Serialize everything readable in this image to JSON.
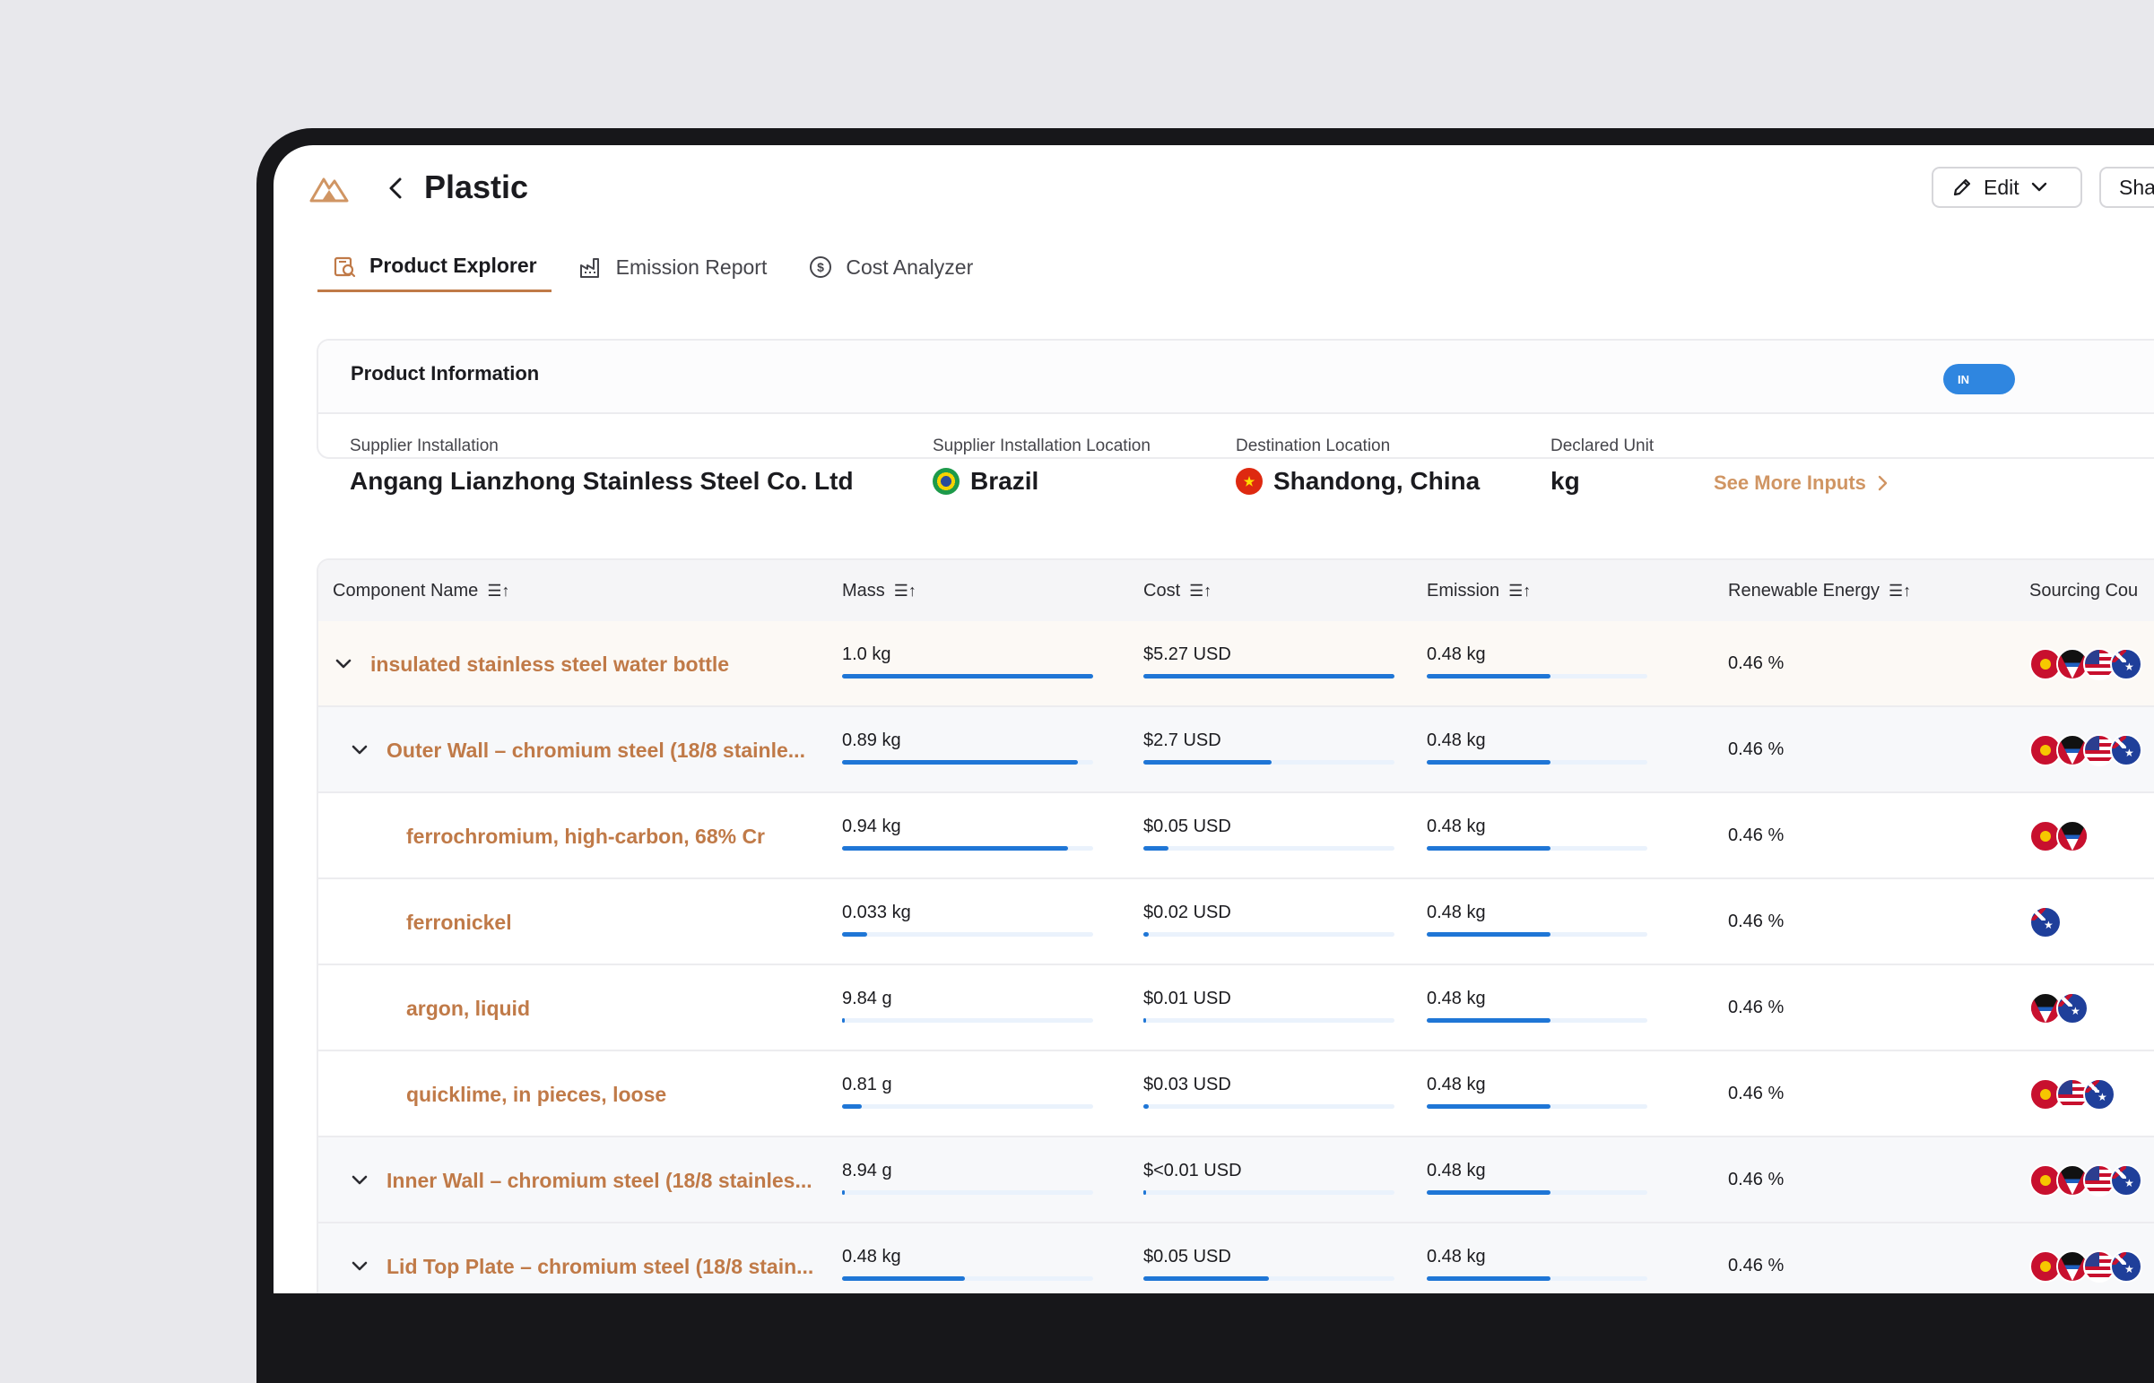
{
  "header": {
    "title": "Plastic",
    "edit_label": "Edit",
    "share_label": "Sha"
  },
  "tabs": [
    {
      "label": "Product Explorer",
      "icon": "product-search-icon",
      "active": true
    },
    {
      "label": "Emission Report",
      "icon": "factory-icon",
      "active": false
    },
    {
      "label": "Cost Analyzer",
      "icon": "dollar-circle-icon",
      "active": false
    }
  ],
  "product_info": {
    "title": "Product Information",
    "badge": "IN",
    "supplier_installation_label": "Supplier Installation",
    "supplier_installation_value": "Angang Lianzhong Stainless Steel Co. Ltd",
    "supplier_location_label": "Supplier Installation Location",
    "supplier_location_value": "Brazil",
    "destination_label": "Destination Location",
    "destination_value": "Shandong, China",
    "declared_unit_label": "Declared Unit",
    "declared_unit_value": "kg",
    "see_more": "See More Inputs"
  },
  "table": {
    "columns": [
      "Component Name",
      "Mass",
      "Cost",
      "Emission",
      "Renewable Energy",
      "Sourcing Cou"
    ],
    "rows": [
      {
        "name": "insulated stainless steel water bottle",
        "level": 0,
        "expandable": true,
        "mass": "1.0 kg",
        "mass_fill": 1.0,
        "cost": "$5.27 USD",
        "cost_fill": 1.0,
        "emission": "0.48 kg",
        "emission_fill": 0.56,
        "renewable": "0.46 %",
        "flags": [
          "kg",
          "ag",
          "us",
          "au"
        ]
      },
      {
        "name": "Outer Wall – chromium steel (18/8 stainle...",
        "level": 1,
        "expandable": true,
        "mass": "0.89 kg",
        "mass_fill": 0.94,
        "cost": "$2.7 USD",
        "cost_fill": 0.51,
        "emission": "0.48 kg",
        "emission_fill": 0.56,
        "renewable": "0.46 %",
        "flags": [
          "kg",
          "ag",
          "us",
          "au"
        ]
      },
      {
        "name": "ferrochromium, high-carbon, 68% Cr",
        "level": 2,
        "expandable": false,
        "mass": "0.94 kg",
        "mass_fill": 0.9,
        "cost": "$0.05 USD",
        "cost_fill": 0.1,
        "emission": "0.48 kg",
        "emission_fill": 0.56,
        "renewable": "0.46 %",
        "flags": [
          "kg",
          "ag"
        ]
      },
      {
        "name": "ferronickel",
        "level": 2,
        "expandable": false,
        "mass": "0.033 kg",
        "mass_fill": 0.1,
        "cost": "$0.02 USD",
        "cost_fill": 0.02,
        "emission": "0.48 kg",
        "emission_fill": 0.56,
        "renewable": "0.46 %",
        "flags": [
          "au"
        ]
      },
      {
        "name": "argon, liquid",
        "level": 2,
        "expandable": false,
        "mass": "9.84 g",
        "mass_fill": 0.01,
        "cost": "$0.01 USD",
        "cost_fill": 0.01,
        "emission": "0.48 kg",
        "emission_fill": 0.56,
        "renewable": "0.46 %",
        "flags": [
          "ag",
          "au"
        ]
      },
      {
        "name": "quicklime, in pieces, loose",
        "level": 2,
        "expandable": false,
        "mass": "0.81 g",
        "mass_fill": 0.08,
        "cost": "$0.03 USD",
        "cost_fill": 0.02,
        "emission": "0.48 kg",
        "emission_fill": 0.56,
        "renewable": "0.46 %",
        "flags": [
          "kg",
          "us",
          "au"
        ]
      },
      {
        "name": "Inner Wall – chromium steel (18/8 stainles...",
        "level": 1,
        "expandable": true,
        "mass": "8.94 g",
        "mass_fill": 0.005,
        "cost": "$<0.01 USD",
        "cost_fill": 0.005,
        "emission": "0.48 kg",
        "emission_fill": 0.56,
        "renewable": "0.46 %",
        "flags": [
          "kg",
          "ag",
          "us",
          "au"
        ]
      },
      {
        "name": "Lid Top Plate – chromium steel (18/8 stain...",
        "level": 1,
        "expandable": true,
        "mass": "0.48 kg",
        "mass_fill": 0.49,
        "cost": "$0.05 USD",
        "cost_fill": 0.5,
        "emission": "0.48 kg",
        "emission_fill": 0.56,
        "renewable": "0.46 %",
        "flags": [
          "kg",
          "ag",
          "us",
          "au"
        ]
      }
    ]
  },
  "colors": {
    "accent": "#c07a48",
    "bar": "#1f76d6",
    "badge": "#2f86e0"
  }
}
